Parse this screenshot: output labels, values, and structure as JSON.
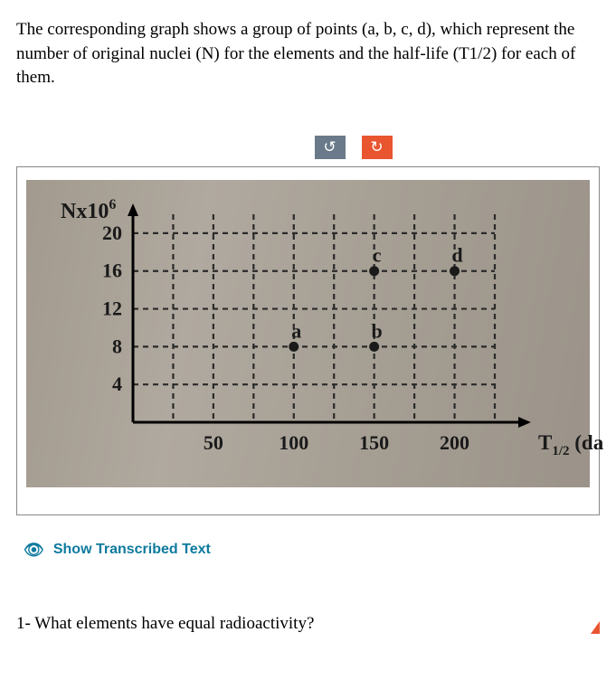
{
  "problem_text": "The corresponding graph shows a group of points (a, b, c, d), which represent the number of original nuclei (N) for the elements and the half-life (T1/2) for each of them.",
  "toolbar": {
    "rotate_left": "↺",
    "rotate_right": "↻"
  },
  "chart_data": {
    "type": "scatter",
    "ylabel_prefix": "Nx10",
    "ylabel_exp": "6",
    "xlabel_prefix": "T",
    "xlabel_sub": "1/2",
    "xlabel_suffix": " (day)",
    "x_ticks": [
      50,
      100,
      150,
      200
    ],
    "y_ticks": [
      4,
      8,
      12,
      16,
      20
    ],
    "xlim": [
      0,
      225
    ],
    "ylim": [
      0,
      22
    ],
    "grid_x": [
      25,
      50,
      75,
      100,
      125,
      150,
      175,
      200,
      225
    ],
    "grid_y": [
      4,
      8,
      12,
      16,
      20
    ],
    "points": [
      {
        "label": "a",
        "x": 100,
        "y": 8
      },
      {
        "label": "b",
        "x": 150,
        "y": 8
      },
      {
        "label": "c",
        "x": 150,
        "y": 16
      },
      {
        "label": "d",
        "x": 200,
        "y": 16
      }
    ]
  },
  "transcribed_link": "Show Transcribed Text",
  "question_1": "1- What elements have equal radioactivity?"
}
